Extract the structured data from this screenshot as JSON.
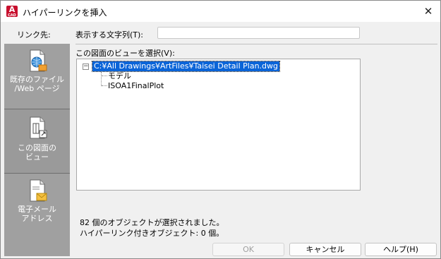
{
  "window": {
    "title": "ハイパーリンクを挿入",
    "app_icon_letter": "A",
    "app_icon_sub": "CAD"
  },
  "close_glyph": "✕",
  "link_to_label": "リンク先:",
  "sidebar": {
    "items": [
      {
        "label_line1": "既存のファイル",
        "label_line2": "/Web ページ",
        "icon": "file-web-icon"
      },
      {
        "label_line1": "この図面の",
        "label_line2": "ビュー",
        "icon": "drawing-view-icon"
      },
      {
        "label_line1": "電子メール",
        "label_line2": "アドレス",
        "icon": "email-icon"
      }
    ]
  },
  "display_text": {
    "label": "表示する文字列(T):",
    "value": ""
  },
  "view_select_label": "この図面のビューを選択(V):",
  "tree": {
    "root": "C:¥All Drawings¥ArtFiles¥Taisei Detail Plan.dwg",
    "expander": "−",
    "children": [
      "モデル",
      "ISOA1FinalPlot"
    ]
  },
  "status": {
    "selected": "82 個のオブジェクトが選択されました。",
    "hyperlinked": "ハイパーリンク付きオブジェクト: 0 個。"
  },
  "buttons": {
    "ok": "OK",
    "cancel": "キャンセル",
    "help": "ヘルプ(H)"
  },
  "colors": {
    "accent": "#0a64d8",
    "sidebar_bg": "#a0a0a0",
    "app_icon": "#c8102e"
  }
}
